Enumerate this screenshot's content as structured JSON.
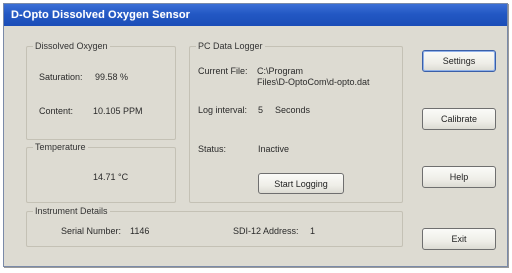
{
  "window": {
    "title": "D-Opto Dissolved Oxygen Sensor"
  },
  "dissolved_oxygen": {
    "legend": "Dissolved Oxygen",
    "saturation_label": "Saturation:",
    "saturation_value": "99.58 %",
    "content_label": "Content:",
    "content_value": "10.105 PPM"
  },
  "temperature": {
    "legend": "Temperature",
    "value": "14.71 °C"
  },
  "logger": {
    "legend": "PC Data Logger",
    "current_file_label": "Current File:",
    "current_file_value": "C:\\Program\nFiles\\D-OptoCom\\d-opto.dat",
    "log_interval_label": "Log interval:",
    "log_interval_value": "5",
    "log_interval_unit": "Seconds",
    "status_label": "Status:",
    "status_value": "Inactive",
    "start_button": "Start Logging"
  },
  "instrument": {
    "legend": "Instrument Details",
    "serial_label": "Serial Number:",
    "serial_value": "1146",
    "sdi_label": "SDI-12 Address:",
    "sdi_value": "1"
  },
  "buttons": {
    "settings": "Settings",
    "calibrate": "Calibrate",
    "help": "Help",
    "exit": "Exit"
  }
}
